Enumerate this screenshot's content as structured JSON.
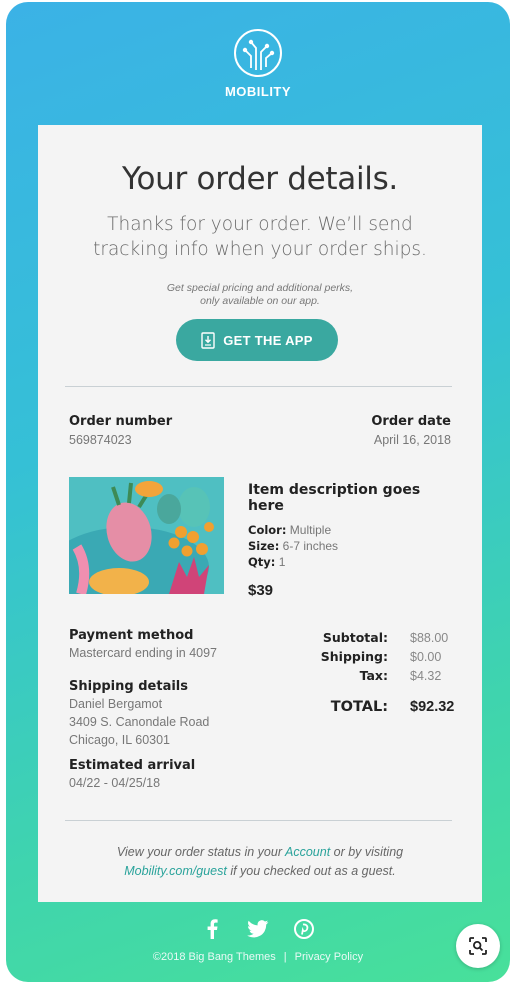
{
  "brand": {
    "name": "MOBILITY"
  },
  "hero": {
    "title": "Your order details.",
    "subtitle": "Thanks for your order. We’ll send tracking info when your order ships.",
    "promo_line1": "Get special pricing and additional perks,",
    "promo_line2": "only available on our app.",
    "app_button": "GET THE APP"
  },
  "order": {
    "number_label": "Order number",
    "number_value": "569874023",
    "date_label": "Order date",
    "date_value": "April 16, 2018"
  },
  "item": {
    "title": "Item description goes here",
    "color_label": "Color:",
    "color_value": "Multiple",
    "size_label": "Size:",
    "size_value": "6-7 inches",
    "qty_label": "Qty:",
    "qty_value": "1",
    "price": "$39"
  },
  "payment": {
    "label": "Payment method",
    "value": "Mastercard ending in 4097"
  },
  "shipping": {
    "label": "Shipping details",
    "name": "Daniel Bergamot",
    "street": "3409 S. Canondale Road",
    "city": "Chicago, IL 60301"
  },
  "arrival": {
    "label": "Estimated arrival",
    "value": "04/22 - 04/25/18"
  },
  "totals": {
    "subtotal_label": "Subtotal:",
    "subtotal_value": "$88.00",
    "shipping_label": "Shipping:",
    "shipping_value": "$0.00",
    "tax_label": "Tax:",
    "tax_value": "$4.32",
    "total_label": "TOTAL:",
    "total_value": "$92.32"
  },
  "footer_note": {
    "part1": "View your order status in your ",
    "account_link": "Account",
    "part2": " or by visiting",
    "guest_link": "Mobility.com/guest",
    "part3": " if you checked out as a guest."
  },
  "footer": {
    "copyright": "©2018 Big Bang Themes",
    "separator": "|",
    "privacy": "Privacy Policy"
  },
  "icons": {
    "logo": "circuit-logo-icon",
    "app": "phone-download-icon",
    "social": [
      "facebook-icon",
      "twitter-icon",
      "pinterest-icon"
    ],
    "lens": "image-search-icon"
  },
  "colors": {
    "gradient_top": "#3bb2e6",
    "gradient_bottom": "#48e09a",
    "accent": "#3aa8a0",
    "link": "#2aa39b"
  }
}
